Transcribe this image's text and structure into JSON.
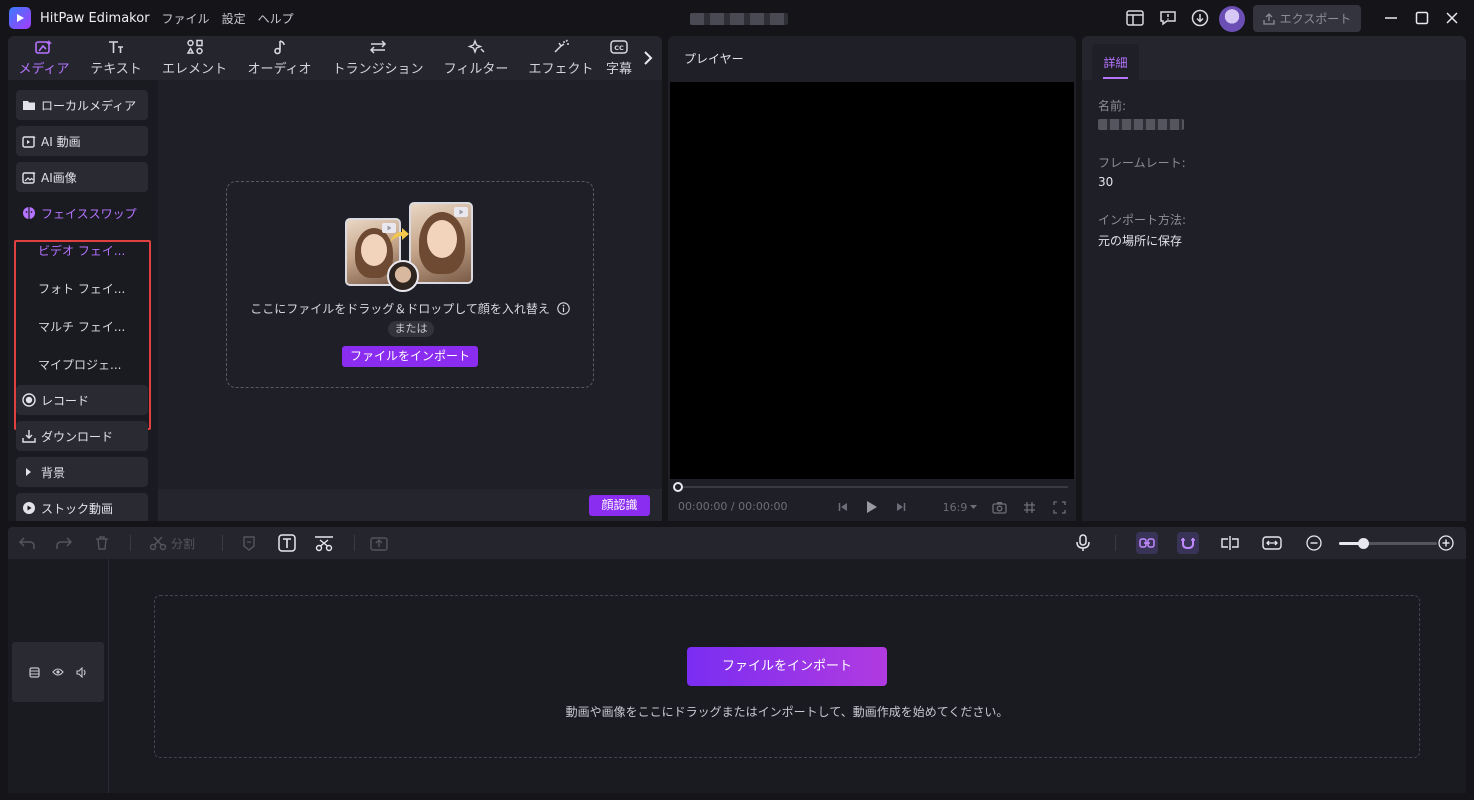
{
  "app": {
    "name": "HitPaw Edimakor",
    "menu": [
      "ファイル",
      "設定",
      "ヘルプ"
    ],
    "export_label": "エクスポート"
  },
  "tabs": [
    {
      "label": "メディア",
      "icon": "media-icon",
      "active": true
    },
    {
      "label": "テキスト",
      "icon": "text-icon"
    },
    {
      "label": "エレメント",
      "icon": "element-icon"
    },
    {
      "label": "オーディオ",
      "icon": "audio-icon"
    },
    {
      "label": "トランジション",
      "icon": "transition-icon"
    },
    {
      "label": "フィルター",
      "icon": "filter-icon"
    },
    {
      "label": "エフェクト",
      "icon": "effect-icon"
    },
    {
      "label": "字幕",
      "icon": "subtitle-icon"
    }
  ],
  "sidebar": {
    "items": [
      {
        "label": "ローカルメディア",
        "icon": "folder-icon"
      },
      {
        "label": "AI 動画",
        "icon": "ai-video-icon"
      },
      {
        "label": "AI画像",
        "icon": "ai-image-icon"
      },
      {
        "label": "フェイススワップ",
        "icon": "face-swap-icon"
      },
      {
        "label": "レコード",
        "icon": "record-icon"
      },
      {
        "label": "ダウンロード",
        "icon": "download-icon"
      },
      {
        "label": "背景",
        "icon": "caret-right-icon"
      },
      {
        "label": "ストック動画",
        "icon": "play-icon"
      }
    ],
    "subitems": [
      "ビデオ フェイ...",
      "フォト フェイ...",
      "マルチ フェイ...",
      "マイプロジェ..."
    ]
  },
  "media": {
    "drop_text": "ここにファイルをドラッグ＆ドロップして顔を入れ替え",
    "or": "または",
    "import_label": "ファイルをインポート",
    "face_detect_label": "顔認識"
  },
  "player": {
    "title": "プレイヤー",
    "time_current": "00:00:00",
    "time_sep": "/",
    "time_total": "00:00:00",
    "progress": 0,
    "ratio": "16:9"
  },
  "detail": {
    "tab": "詳細",
    "name_label": "名前:",
    "framerate_label": "フレームレート:",
    "framerate_value": "30",
    "import_method_label": "インポート方法:",
    "import_method_value": "元の場所に保存"
  },
  "timeline": {
    "split_label": "分割",
    "import_label": "ファイルをインポート",
    "hint": "動画や画像をここにドラッグまたはインポートして、動画作成を始めてください。",
    "zoom_level": 0.25
  },
  "colors": {
    "accent": "#b574ff",
    "button": "#8a2df0",
    "highlight_frame": "#e04040"
  }
}
